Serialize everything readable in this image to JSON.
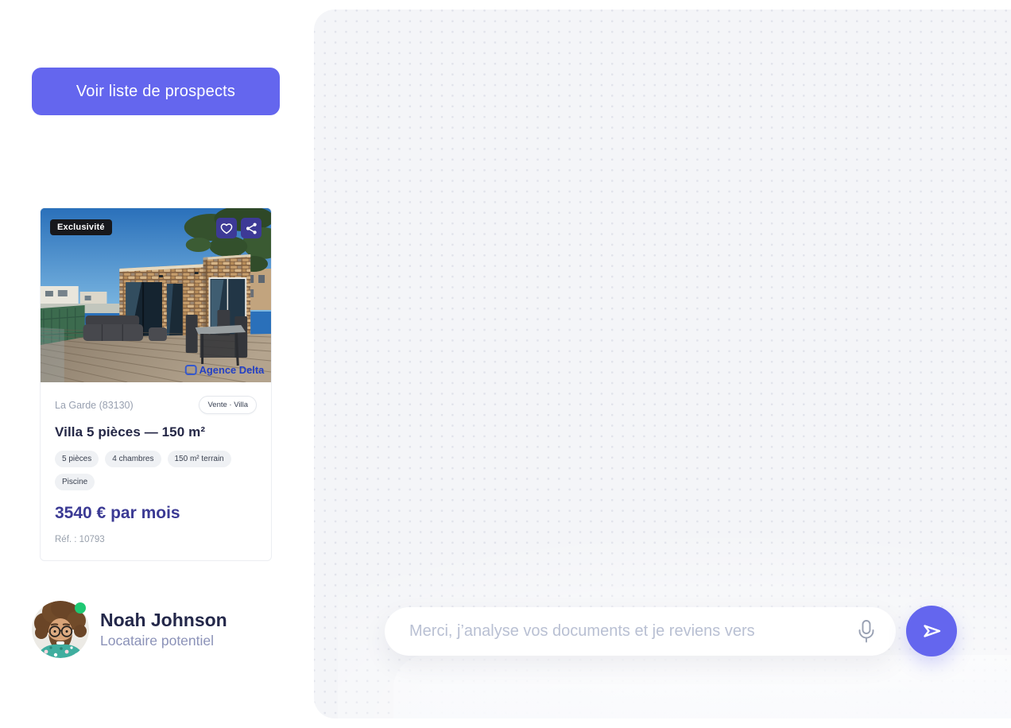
{
  "left_panel": {
    "prospects_button_label": "Voir liste de prospects",
    "property_card": {
      "exclusivity_badge": "Exclusivité",
      "watermark": "Agence Delta",
      "location": "La Garde (83130)",
      "listing_type": "Vente · Villa",
      "title": "Villa 5 pièces — 150 m²",
      "tags": [
        "5 pièces",
        "4 chambres",
        "150 m² terrain",
        "Piscine"
      ],
      "price": "3540 € par mois",
      "reference": "Réf. : 10793"
    },
    "user": {
      "name": "Noah Johnson",
      "role": "Locataire potentiel",
      "online": true
    }
  },
  "chat_panel": {
    "input_placeholder": "Merci, j’analyse vos documents et je reviens vers"
  },
  "icons": {
    "favorite": "heart-icon",
    "share": "share-icon",
    "microphone": "microphone-icon",
    "send": "send-paper-plane-icon",
    "online": "online-status-dot"
  },
  "colors": {
    "accent_purple": "#6466ee",
    "icon_tile_indigo": "#3d3a96",
    "price_text": "#3b3a94",
    "heading_text": "#24284a",
    "muted_text": "#98a0b0",
    "online_green": "#1ec873",
    "chat_panel_bg": "#f4f5f8",
    "dot_grid": "#e1e3eb",
    "watermark_blue": "#2440c4"
  }
}
